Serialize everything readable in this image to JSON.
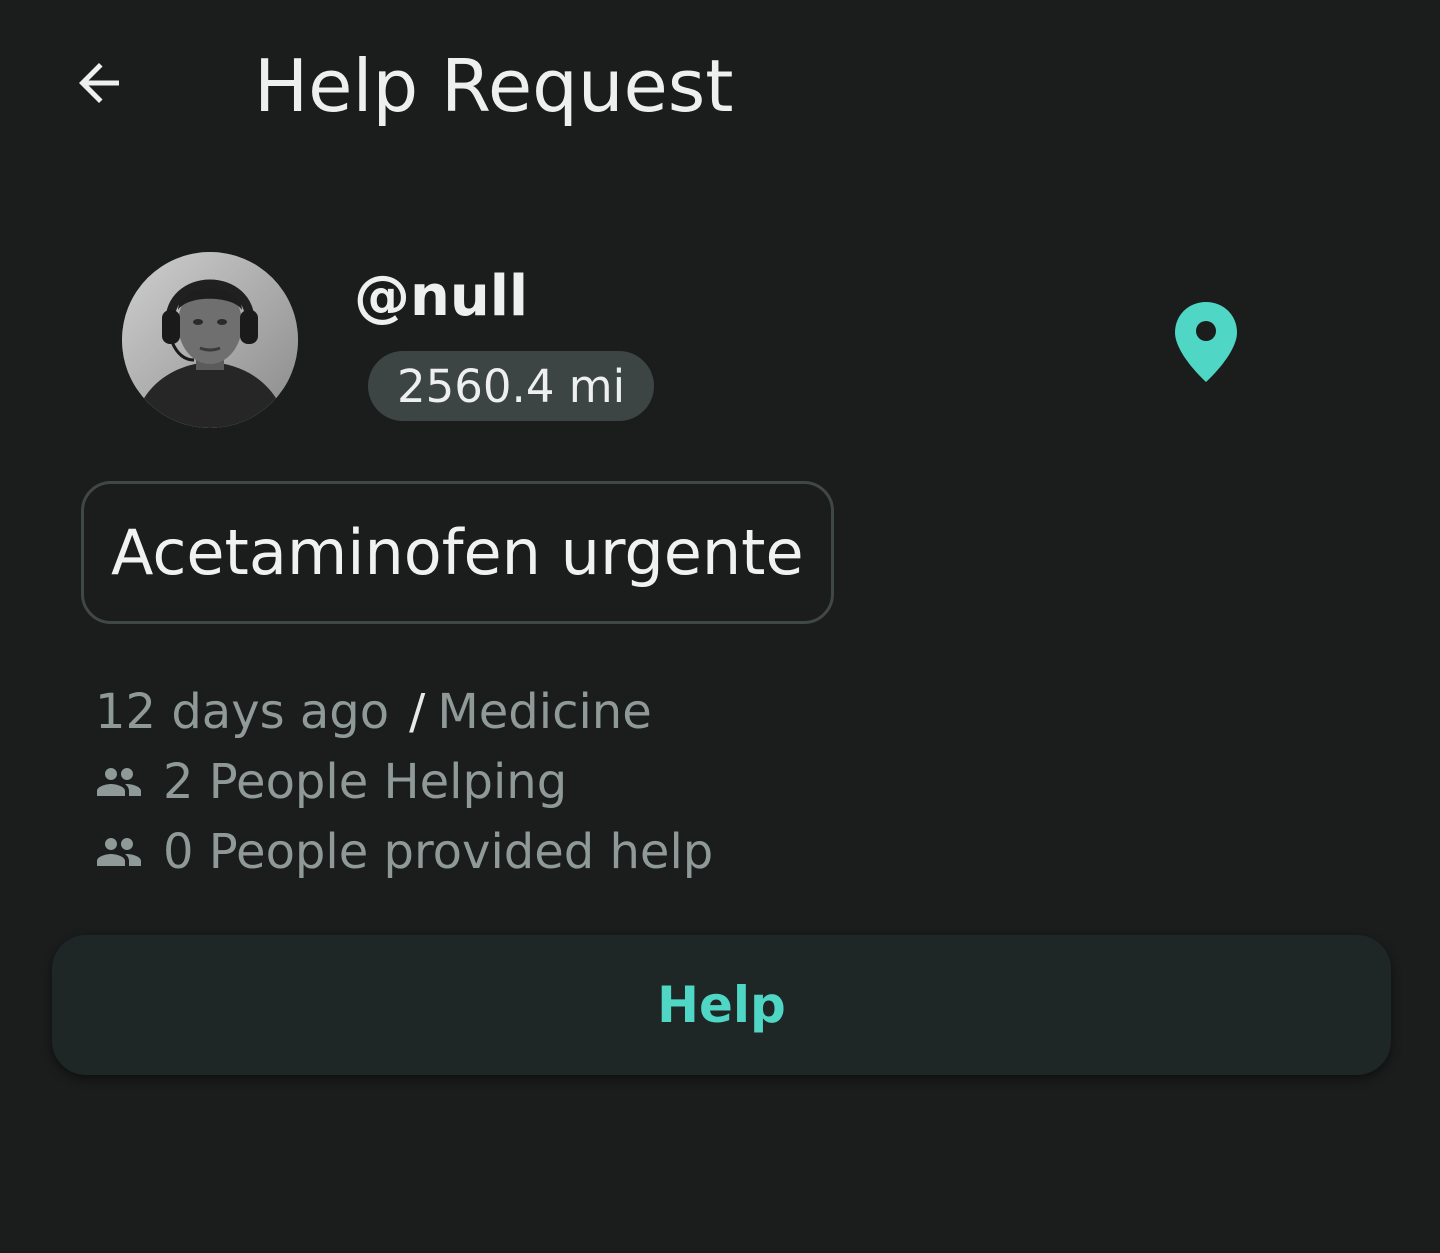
{
  "header": {
    "back_icon": "arrow-left-icon",
    "title": "Help Request"
  },
  "profile": {
    "username": "@null",
    "distance": "2560.4 mi",
    "location_icon": "map-pin-icon"
  },
  "request": {
    "title": "Acetaminofen urgente",
    "time_ago": "12 days ago",
    "separator": "/",
    "category": "Medicine",
    "helping_icon": "people-icon",
    "helping_text": "2 People Helping",
    "provided_icon": "people-icon",
    "provided_text": "0 People provided help"
  },
  "actions": {
    "help_label": "Help"
  },
  "colors": {
    "background": "#1b1c1c",
    "accent": "#4fd6c4",
    "chip": "#3d4544",
    "muted_text": "#8f9998",
    "button_bg": "#1e2726"
  }
}
